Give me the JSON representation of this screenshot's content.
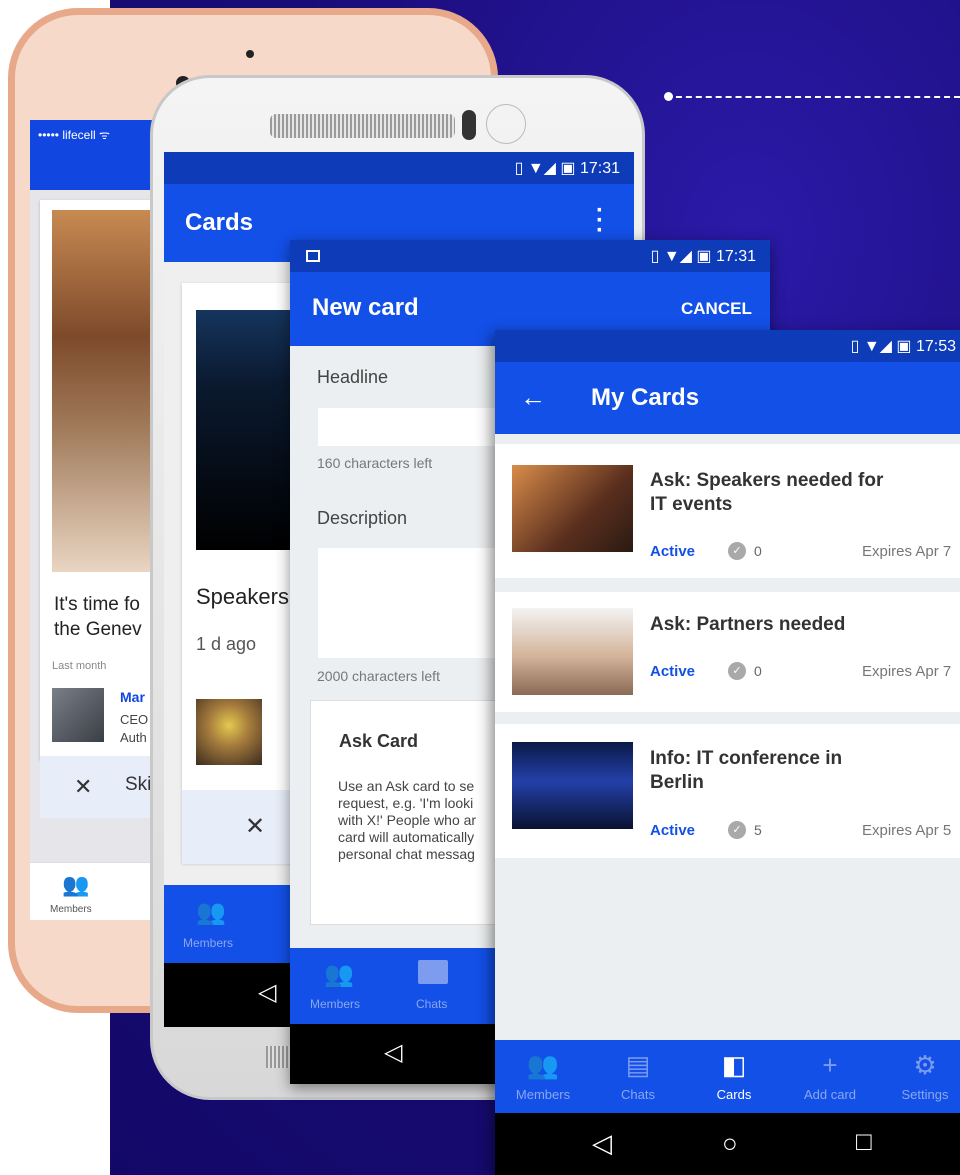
{
  "iphone": {
    "status_carrier": "••••• lifecell ᯤ",
    "card_title_line1": "It's time fo",
    "card_title_line2": "the Genev",
    "last_month": "Last month",
    "author_name": "Mar",
    "author_role_1": "CEO",
    "author_role_2": "Auth",
    "skip_x": "✕",
    "skip_label": "Ski",
    "nav_label": "Members"
  },
  "htc": {
    "status_time": "▯ ▼◢ ▣ 17:31",
    "title": "Cards",
    "card_title": "Speakers",
    "card_ago": "1 d ago",
    "skip_x": "✕",
    "nav_label": "Members"
  },
  "new_card": {
    "status_time": "▯ ▼◢ ▣ 17:31",
    "title": "New card",
    "cancel": "CANCEL",
    "headline_label": "Headline",
    "headline_count": "160 characters left",
    "description_label": "Description",
    "description_count": "2000 characters left",
    "ask_title": "Ask Card",
    "ask_body": [
      "Use an Ask card to se",
      "request, e.g. 'I'm looki",
      "with X!' People who ar",
      "card will automatically",
      "personal chat messag"
    ],
    "nav": [
      {
        "label": "Members"
      },
      {
        "label": "Chats"
      }
    ]
  },
  "my_cards": {
    "status_time": "▯ ▼◢ ▣ 17:53",
    "title": "My Cards",
    "items": [
      {
        "title_line1": "Ask: Speakers needed for",
        "title_line2": "IT events",
        "status": "Active",
        "count": "0",
        "expires": "Expires Apr 7"
      },
      {
        "title_line1": "Ask: Partners needed",
        "title_line2": "",
        "status": "Active",
        "count": "0",
        "expires": "Expires Apr 7"
      },
      {
        "title_line1": "Info: IT conference in",
        "title_line2": "Berlin",
        "status": "Active",
        "count": "5",
        "expires": "Expires Apr 5"
      }
    ],
    "nav": [
      {
        "label": "Members",
        "icon": "members-icon"
      },
      {
        "label": "Chats",
        "icon": "chats-icon"
      },
      {
        "label": "Cards",
        "icon": "cards-icon"
      },
      {
        "label": "Add card",
        "icon": "add-icon"
      },
      {
        "label": "Settings",
        "icon": "gear-icon"
      }
    ]
  },
  "colors": {
    "brand": "#1350e8",
    "status_bar": "#0e3bb8",
    "background": "#1a0c78"
  }
}
